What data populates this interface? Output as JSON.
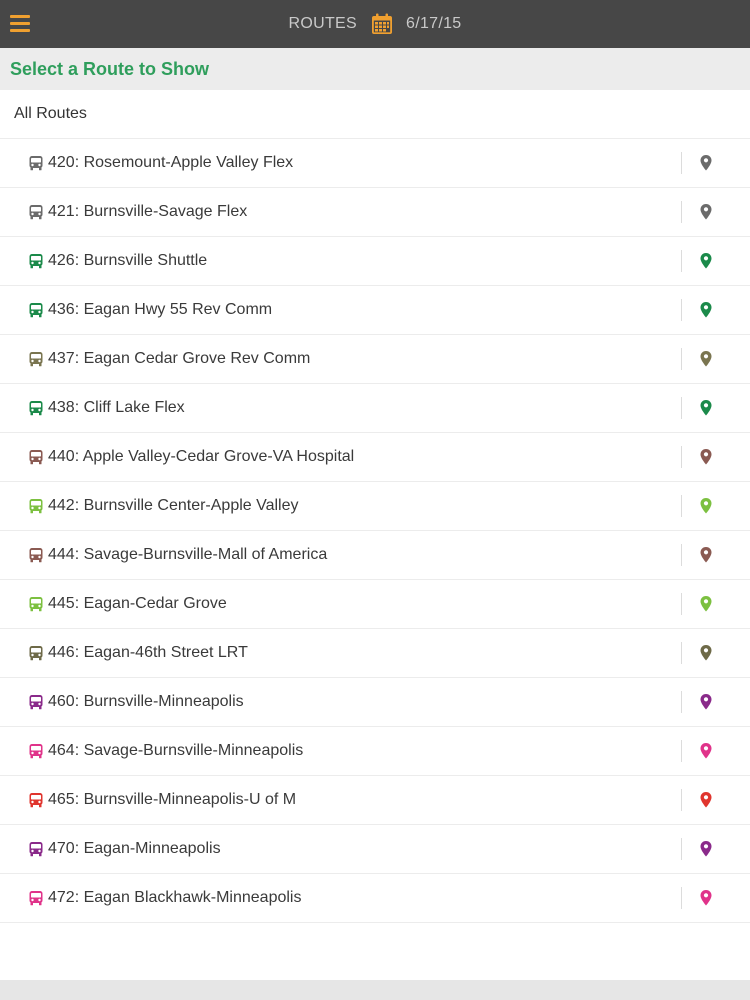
{
  "header": {
    "title": "ROUTES",
    "date": "6/17/15",
    "menu_icon": "hamburger-menu-icon",
    "calendar_icon": "calendar-icon",
    "accent_color": "#f0a030",
    "bar_color": "#474747"
  },
  "subheader": {
    "title": "Select a Route to Show",
    "color": "#2f9e5c"
  },
  "all_routes_label": "All Routes",
  "routes": [
    {
      "label": "420: Rosemount-Apple Valley Flex",
      "color": "#6b6b6b"
    },
    {
      "label": "421: Burnsville-Savage Flex",
      "color": "#6b6b6b"
    },
    {
      "label": "426: Burnsville Shuttle",
      "color": "#1b8a4a"
    },
    {
      "label": "436: Eagan Hwy 55 Rev Comm",
      "color": "#1b8a4a"
    },
    {
      "label": "437: Eagan Cedar Grove Rev Comm",
      "color": "#7a7550"
    },
    {
      "label": "438: Cliff Lake Flex",
      "color": "#1b8a4a"
    },
    {
      "label": "440: Apple Valley-Cedar Grove-VA Hospital",
      "color": "#8a5a52"
    },
    {
      "label": "442: Burnsville Center-Apple Valley",
      "color": "#7cc040"
    },
    {
      "label": "444: Savage-Burnsville-Mall of America",
      "color": "#8a5a52"
    },
    {
      "label": "445: Eagan-Cedar Grove",
      "color": "#7cc040"
    },
    {
      "label": "446: Eagan-46th Street LRT",
      "color": "#6e6a48"
    },
    {
      "label": "460: Burnsville-Minneapolis",
      "color": "#8a2a8a"
    },
    {
      "label": "464: Savage-Burnsville-Minneapolis",
      "color": "#e0338a"
    },
    {
      "label": "465: Burnsville-Minneapolis-U of M",
      "color": "#e0352e"
    },
    {
      "label": "470: Eagan-Minneapolis",
      "color": "#8a2a8a"
    },
    {
      "label": "472: Eagan Blackhawk-Minneapolis",
      "color": "#e0338a"
    }
  ],
  "route_icon": "bus-icon",
  "map_icon": "map-pin-icon"
}
